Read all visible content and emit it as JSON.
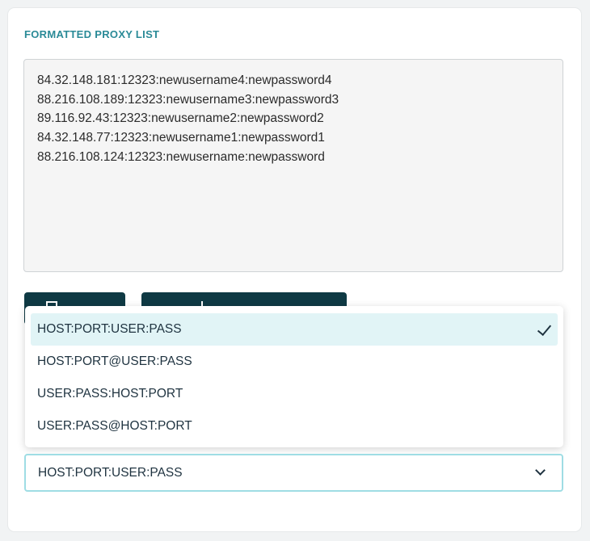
{
  "section": {
    "title": "FORMATTED PROXY LIST"
  },
  "proxy_list": [
    "84.32.148.181:12323:newusername4:newpassword4",
    "88.216.108.189:12323:newusername3:newpassword3",
    "89.116.92.43:12323:newusername2:newpassword2",
    "84.32.148.77:12323:newusername1:newpassword1",
    "88.216.108.124:12323:newusername:newpassword"
  ],
  "format_dropdown": {
    "selected": "HOST:PORT:USER:PASS",
    "options": [
      "HOST:PORT:USER:PASS",
      "HOST:PORT@USER:PASS",
      "USER:PASS:HOST:PORT",
      "USER:PASS@HOST:PORT"
    ],
    "check_icon": "check-icon",
    "chevron_icon": "chevron-down-icon"
  },
  "colors": {
    "accent": "#2a8a97",
    "button_bg": "#0f3a44",
    "selected_option_bg": "#e1f4f6",
    "select_border": "#9fdde4"
  }
}
